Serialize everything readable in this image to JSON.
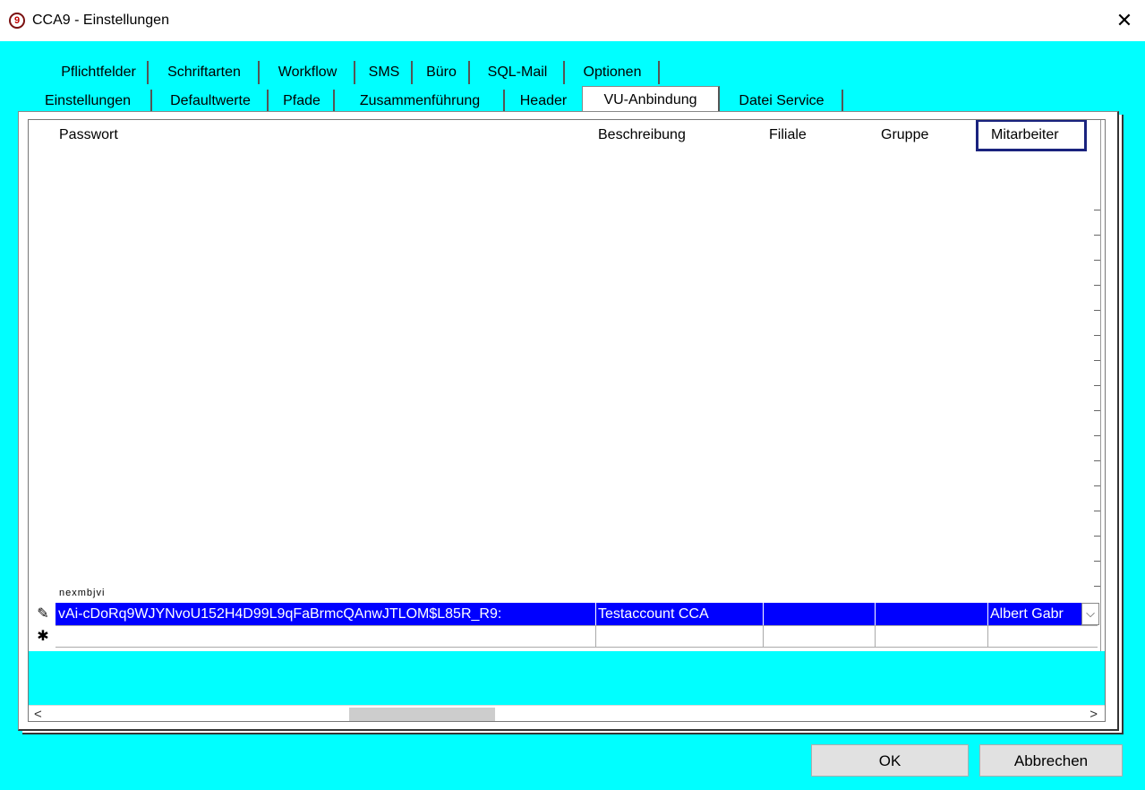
{
  "window": {
    "title": "CCA9 - Einstellungen",
    "icon_glyph": "9",
    "close_glyph": "✕"
  },
  "tabs_row1": [
    "Pflichtfelder",
    "Schriftarten",
    "Workflow",
    "SMS",
    "Büro",
    "SQL-Mail",
    "Optionen"
  ],
  "tabs_row2": [
    "Einstellungen",
    "Defaultwerte",
    "Pfade",
    "Zusammenführung",
    "Header",
    "VU-Anbindung",
    "Datei Service"
  ],
  "active_tab": "VU-Anbindung",
  "grid": {
    "columns": [
      "Passwort",
      "Beschreibung",
      "Filiale",
      "Gruppe",
      "Mitarbeiter"
    ],
    "highlighted_column": "Mitarbeiter",
    "cutoff_text": "nexmbjvi",
    "selected_row": {
      "indicator": "✎",
      "passwort": "vAi-cDoRq9WJYNvoU152H4D99L9qFaBrmcQAnwJTLOM$L85R_R9:",
      "beschreibung": "Testaccount CCA",
      "filiale": "",
      "gruppe": "",
      "mitarbeiter": "Albert Gabr"
    },
    "new_row_indicator": "✱",
    "dropdown_glyph": "⌵"
  },
  "scroll": {
    "left_glyph": "<",
    "right_glyph": ">"
  },
  "buttons": {
    "ok": "OK",
    "cancel": "Abbrechen"
  },
  "colors": {
    "background": "#00ffff",
    "selection": "#0000ff",
    "highlight_box": "#1a237e"
  }
}
